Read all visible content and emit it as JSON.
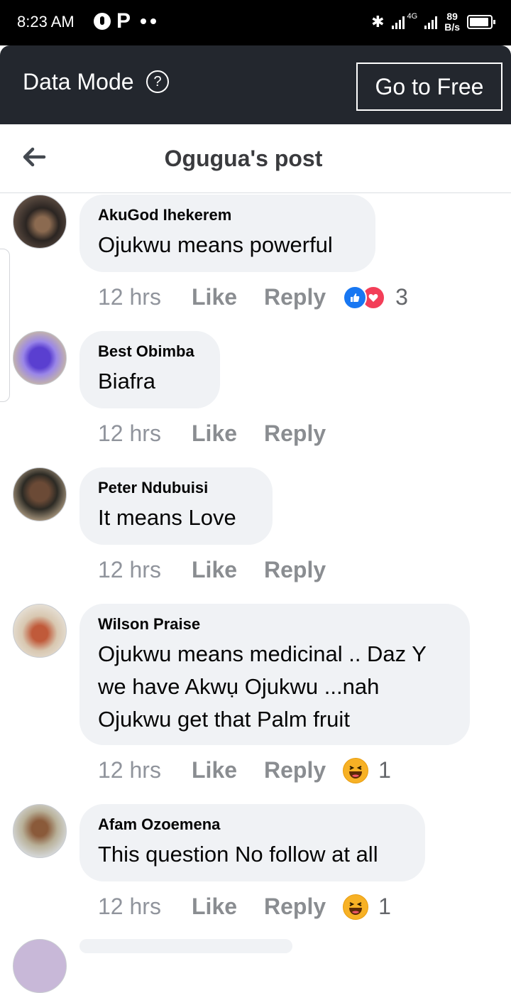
{
  "status_bar": {
    "time": "8:23 AM",
    "network": "4G",
    "speed_value": "89",
    "speed_unit": "B/s"
  },
  "data_mode": {
    "label": "Data Mode",
    "info_icon": "?",
    "go_free_label": "Go to Free"
  },
  "header": {
    "title": "Ogugua's post"
  },
  "colors": {
    "bubble": "#f0f2f5",
    "like_blue": "#1877f2",
    "love_red": "#f33e58",
    "haha_yellow": "#f7b125"
  },
  "comments": [
    {
      "author": "AkuGod Ihekerem",
      "lines": [
        "Ojukwu means powerful"
      ],
      "time": "12 hrs",
      "like_label": "Like",
      "reply_label": "Reply",
      "reactions": [
        "like-icon",
        "love-icon"
      ],
      "reaction_count": "3"
    },
    {
      "author": "Best Obimba",
      "lines": [
        "Biafra"
      ],
      "time": "12 hrs",
      "like_label": "Like",
      "reply_label": "Reply"
    },
    {
      "author": "Peter Ndubuisi",
      "lines": [
        "It means Love"
      ],
      "time": "12 hrs",
      "like_label": "Like",
      "reply_label": "Reply"
    },
    {
      "author": "Wilson Praise",
      "lines": [
        "Ojukwu means medicinal .. Daz Y",
        "we have Akwụ Ojukwu ...nah",
        "Ojukwu get that Palm fruit"
      ],
      "time": "12 hrs",
      "like_label": "Like",
      "reply_label": "Reply",
      "reactions": [
        "haha-icon"
      ],
      "reaction_count": "1"
    },
    {
      "author": "Afam Ozoemena",
      "lines": [
        "This question No follow at all"
      ],
      "time": "12 hrs",
      "like_label": "Like",
      "reply_label": "Reply",
      "reactions": [
        "haha-icon"
      ],
      "reaction_count": "1"
    }
  ]
}
